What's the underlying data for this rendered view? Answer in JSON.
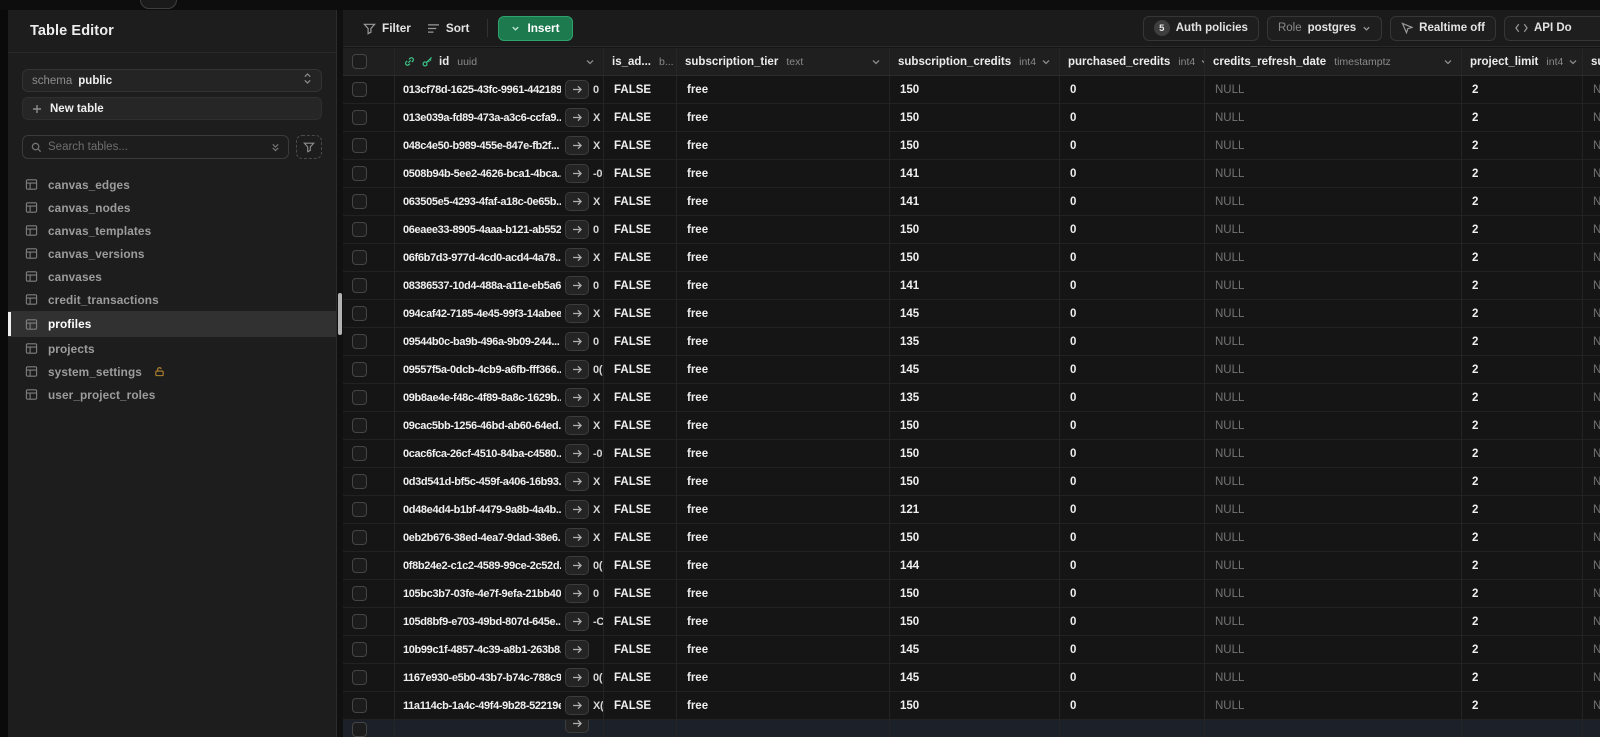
{
  "sidebar": {
    "title": "Table Editor",
    "schema_label": "schema",
    "schema_value": "public",
    "new_table_label": "New table",
    "search_placeholder": "Search tables...",
    "tables": [
      {
        "name": "canvas_edges",
        "selected": false,
        "locked": false
      },
      {
        "name": "canvas_nodes",
        "selected": false,
        "locked": false
      },
      {
        "name": "canvas_templates",
        "selected": false,
        "locked": false
      },
      {
        "name": "canvas_versions",
        "selected": false,
        "locked": false
      },
      {
        "name": "canvases",
        "selected": false,
        "locked": false
      },
      {
        "name": "credit_transactions",
        "selected": false,
        "locked": false
      },
      {
        "name": "profiles",
        "selected": true,
        "locked": false
      },
      {
        "name": "projects",
        "selected": false,
        "locked": false
      },
      {
        "name": "system_settings",
        "selected": false,
        "locked": true
      },
      {
        "name": "user_project_roles",
        "selected": false,
        "locked": false
      }
    ]
  },
  "toolbar": {
    "filter_label": "Filter",
    "sort_label": "Sort",
    "insert_label": "Insert",
    "auth_policies_count": "5",
    "auth_policies_label": "Auth policies",
    "role_label": "Role",
    "role_value": "postgres",
    "realtime_label": "Realtime off",
    "api_docs_label": "API Do"
  },
  "grid": {
    "columns": [
      {
        "name": "id",
        "type": "uuid"
      },
      {
        "name": "is_ad...",
        "type": "b..."
      },
      {
        "name": "subscription_tier",
        "type": "text"
      },
      {
        "name": "subscription_credits",
        "type": "int4"
      },
      {
        "name": "purchased_credits",
        "type": "int4"
      },
      {
        "name": "credits_refresh_date",
        "type": "timestamptz"
      },
      {
        "name": "project_limit",
        "type": "int4"
      },
      {
        "name": "su",
        "type": ""
      }
    ],
    "rows": [
      {
        "id": "013cf78d-1625-43fc-9961-442189...",
        "clip": "0",
        "is_admin": "FALSE",
        "tier": "free",
        "sub_credits": "150",
        "purchased": "0",
        "refresh": "NULL",
        "limit": "2",
        "last": "NU"
      },
      {
        "id": "013e039a-fd89-473a-a3c6-ccfa9...",
        "clip": "X",
        "is_admin": "FALSE",
        "tier": "free",
        "sub_credits": "150",
        "purchased": "0",
        "refresh": "NULL",
        "limit": "2",
        "last": "NU"
      },
      {
        "id": "048c4e50-b989-455e-847e-fb2f...",
        "clip": "X",
        "is_admin": "FALSE",
        "tier": "free",
        "sub_credits": "150",
        "purchased": "0",
        "refresh": "NULL",
        "limit": "2",
        "last": "NU"
      },
      {
        "id": "0508b94b-5ee2-4626-bca1-4bca...",
        "clip": "-0",
        "is_admin": "FALSE",
        "tier": "free",
        "sub_credits": "141",
        "purchased": "0",
        "refresh": "NULL",
        "limit": "2",
        "last": "NU"
      },
      {
        "id": "063505e5-4293-4faf-a18c-0e65b...",
        "clip": "X",
        "is_admin": "FALSE",
        "tier": "free",
        "sub_credits": "141",
        "purchased": "0",
        "refresh": "NULL",
        "limit": "2",
        "last": "NU"
      },
      {
        "id": "06eaee33-8905-4aaa-b121-ab552...",
        "clip": "0",
        "is_admin": "FALSE",
        "tier": "free",
        "sub_credits": "150",
        "purchased": "0",
        "refresh": "NULL",
        "limit": "2",
        "last": "NU"
      },
      {
        "id": "06f6b7d3-977d-4cd0-acd4-4a78...",
        "clip": "X",
        "is_admin": "FALSE",
        "tier": "free",
        "sub_credits": "150",
        "purchased": "0",
        "refresh": "NULL",
        "limit": "2",
        "last": "NU"
      },
      {
        "id": "08386537-10d4-488a-a11e-eb5a6...",
        "clip": "0",
        "is_admin": "FALSE",
        "tier": "free",
        "sub_credits": "141",
        "purchased": "0",
        "refresh": "NULL",
        "limit": "2",
        "last": "NU"
      },
      {
        "id": "094caf42-7185-4e45-99f3-14abee...",
        "clip": "X",
        "is_admin": "FALSE",
        "tier": "free",
        "sub_credits": "145",
        "purchased": "0",
        "refresh": "NULL",
        "limit": "2",
        "last": "NU"
      },
      {
        "id": "09544b0c-ba9b-496a-9b09-244...",
        "clip": "0",
        "is_admin": "FALSE",
        "tier": "free",
        "sub_credits": "135",
        "purchased": "0",
        "refresh": "NULL",
        "limit": "2",
        "last": "NU"
      },
      {
        "id": "09557f5a-0dcb-4cb9-a6fb-fff366...",
        "clip": "0(",
        "is_admin": "FALSE",
        "tier": "free",
        "sub_credits": "145",
        "purchased": "0",
        "refresh": "NULL",
        "limit": "2",
        "last": "NU"
      },
      {
        "id": "09b8ae4e-f48c-4f89-8a8c-1629b...",
        "clip": "X",
        "is_admin": "FALSE",
        "tier": "free",
        "sub_credits": "135",
        "purchased": "0",
        "refresh": "NULL",
        "limit": "2",
        "last": "NU"
      },
      {
        "id": "09cac5bb-1256-46bd-ab60-64ed...",
        "clip": "X",
        "is_admin": "FALSE",
        "tier": "free",
        "sub_credits": "150",
        "purchased": "0",
        "refresh": "NULL",
        "limit": "2",
        "last": "NU"
      },
      {
        "id": "0cac6fca-26cf-4510-84ba-c4580...",
        "clip": "-0",
        "is_admin": "FALSE",
        "tier": "free",
        "sub_credits": "150",
        "purchased": "0",
        "refresh": "NULL",
        "limit": "2",
        "last": "NU"
      },
      {
        "id": "0d3d541d-bf5c-459f-a406-16b93...",
        "clip": "X",
        "is_admin": "FALSE",
        "tier": "free",
        "sub_credits": "150",
        "purchased": "0",
        "refresh": "NULL",
        "limit": "2",
        "last": "NU"
      },
      {
        "id": "0d48e4d4-b1bf-4479-9a8b-4a4b...",
        "clip": "X",
        "is_admin": "FALSE",
        "tier": "free",
        "sub_credits": "121",
        "purchased": "0",
        "refresh": "NULL",
        "limit": "2",
        "last": "NU"
      },
      {
        "id": "0eb2b676-38ed-4ea7-9dad-38e6...",
        "clip": "X",
        "is_admin": "FALSE",
        "tier": "free",
        "sub_credits": "150",
        "purchased": "0",
        "refresh": "NULL",
        "limit": "2",
        "last": "NU"
      },
      {
        "id": "0f8b24e2-c1c2-4589-99ce-2c52d...",
        "clip": "0(",
        "is_admin": "FALSE",
        "tier": "free",
        "sub_credits": "144",
        "purchased": "0",
        "refresh": "NULL",
        "limit": "2",
        "last": "NU"
      },
      {
        "id": "105bc3b7-03fe-4e7f-9efa-21bb40...",
        "clip": "0",
        "is_admin": "FALSE",
        "tier": "free",
        "sub_credits": "150",
        "purchased": "0",
        "refresh": "NULL",
        "limit": "2",
        "last": "NU"
      },
      {
        "id": "105d8bf9-e703-49bd-807d-645e...",
        "clip": "-C",
        "is_admin": "FALSE",
        "tier": "free",
        "sub_credits": "150",
        "purchased": "0",
        "refresh": "NULL",
        "limit": "2",
        "last": "NU"
      },
      {
        "id": "10b99c1f-4857-4c39-a8b1-263b8...",
        "clip": "",
        "is_admin": "FALSE",
        "tier": "free",
        "sub_credits": "145",
        "purchased": "0",
        "refresh": "NULL",
        "limit": "2",
        "last": "NU"
      },
      {
        "id": "1167e930-e5b0-43b7-b74c-788c9...",
        "clip": "0(",
        "is_admin": "FALSE",
        "tier": "free",
        "sub_credits": "145",
        "purchased": "0",
        "refresh": "NULL",
        "limit": "2",
        "last": "NU"
      },
      {
        "id": "11a114cb-1a4c-49f4-9b28-52219ec...",
        "clip": "X(",
        "is_admin": "FALSE",
        "tier": "free",
        "sub_credits": "150",
        "purchased": "0",
        "refresh": "NULL",
        "limit": "2",
        "last": "NU"
      }
    ],
    "partial_row": true
  },
  "colors": {
    "accent_green": "#3ecf8e",
    "insert_green": "#1d7a4f",
    "lock_amber": "#b5862f",
    "null_grey": "#737373"
  }
}
